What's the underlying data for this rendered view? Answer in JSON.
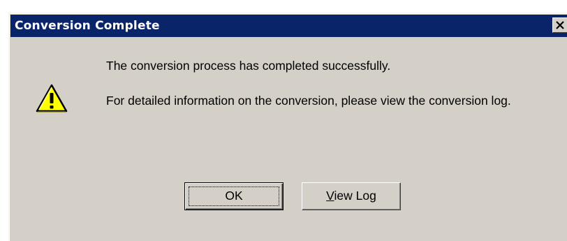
{
  "window": {
    "title": "Conversion Complete",
    "close_glyph": "✕"
  },
  "icon": "warning-icon",
  "messages": {
    "line1": "The conversion process has completed successfully.",
    "line2": "For detailed information on the conversion, please view the conversion log."
  },
  "buttons": {
    "ok_label": "OK",
    "view_log_mnemonic": "V",
    "view_log_rest": "iew Log"
  },
  "colors": {
    "titlebar": "#0a246a",
    "face": "#d4d0c8",
    "warning_yellow": "#ffff00"
  }
}
